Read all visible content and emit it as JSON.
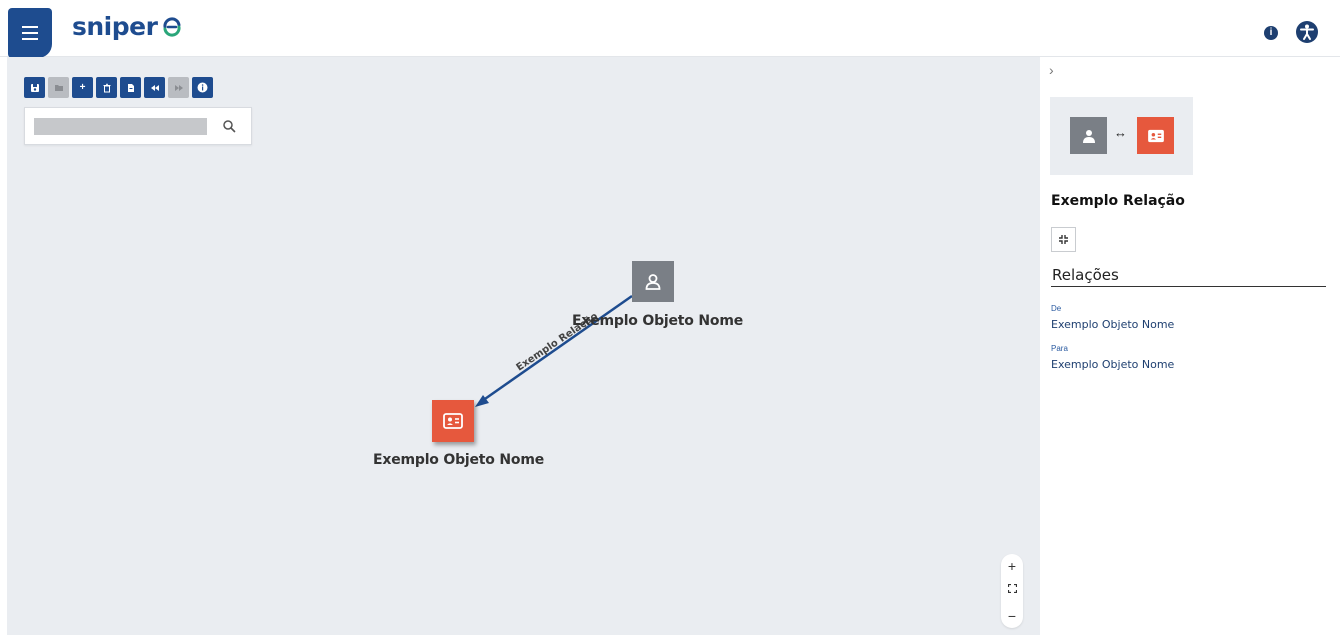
{
  "header": {
    "logo_text": "sniper",
    "info_icon": "info-icon",
    "accessibility_icon": "accessibility-icon"
  },
  "toolbar": {
    "buttons": [
      {
        "icon": "save-icon",
        "enabled": true
      },
      {
        "icon": "folder-open-icon",
        "enabled": false
      },
      {
        "icon": "plus-icon",
        "enabled": true
      },
      {
        "icon": "trash-icon",
        "enabled": true
      },
      {
        "icon": "file-icon",
        "enabled": true
      },
      {
        "icon": "rewind-icon",
        "enabled": true
      },
      {
        "icon": "fast-forward-icon",
        "enabled": false
      },
      {
        "icon": "info-icon",
        "enabled": true
      }
    ]
  },
  "search": {
    "value": ""
  },
  "graph": {
    "nodes": [
      {
        "label": "Exemplo Objeto Nome",
        "type": "person"
      },
      {
        "label": "Exemplo Objeto Nome",
        "type": "id-card"
      }
    ],
    "edge": {
      "label": "Exemplo Relação",
      "color": "#1e4c8f"
    }
  },
  "zoom": {
    "in_label": "+",
    "fit_label": "⛶",
    "out_label": "−"
  },
  "panel": {
    "collapse_label": "›",
    "relation_title": "Exemplo Relação",
    "section_title": "Relações",
    "from_label": "De",
    "from_value": "Exemplo Objeto Nome",
    "to_label": "Para",
    "to_value": "Exemplo Objeto Nome"
  },
  "colors": {
    "brand": "#1e4c8f",
    "person_node": "#7a7f86",
    "card_node": "#e6583d",
    "canvas_bg": "#eaedf1"
  }
}
